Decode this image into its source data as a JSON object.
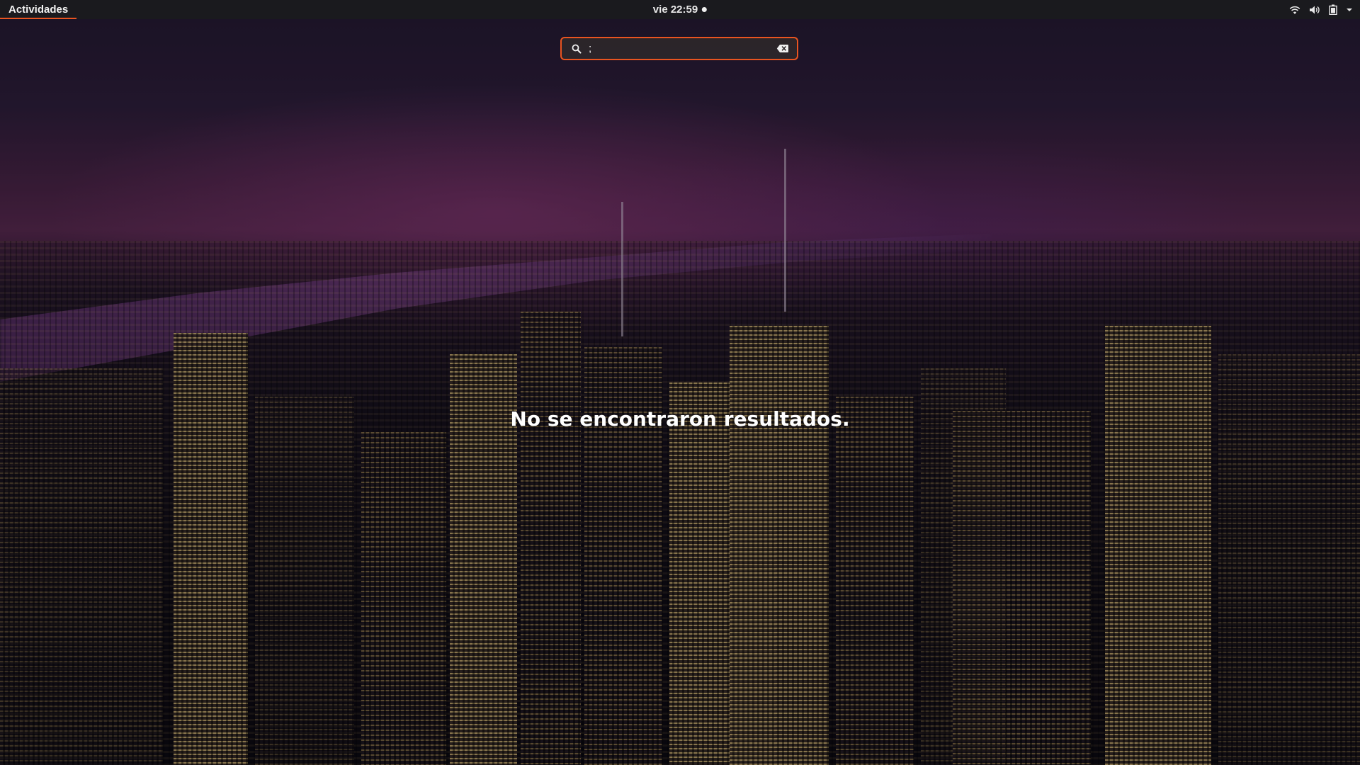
{
  "topbar": {
    "activities_label": "Actividades",
    "clock_label": "vie 22:59",
    "tray_icons": [
      "wifi-icon",
      "volume-icon",
      "battery-icon",
      "chevron-down-icon"
    ]
  },
  "search": {
    "value": ";",
    "placeholder": ""
  },
  "results": {
    "message": "No se encontraron resultados."
  },
  "colors": {
    "accent": "#e95420",
    "topbar_bg": "#1a1a1e"
  }
}
